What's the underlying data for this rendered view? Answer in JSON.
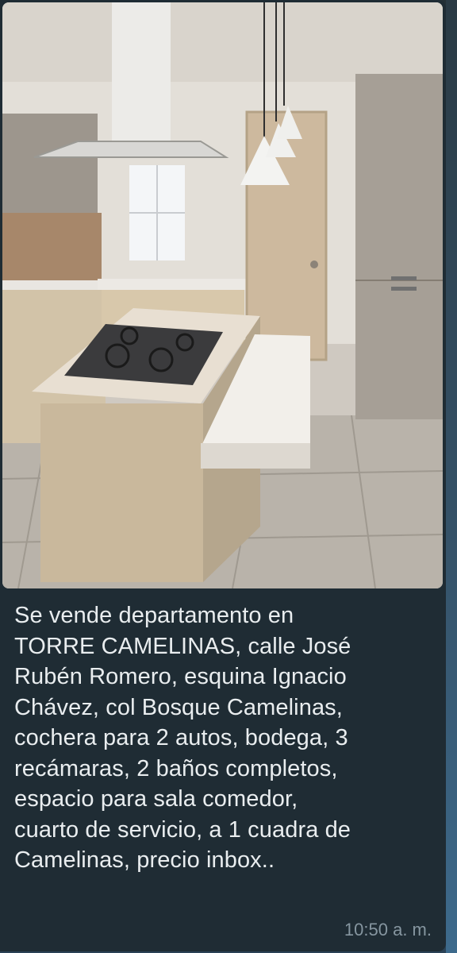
{
  "message": {
    "image": {
      "alt_icon": "kitchen-photo"
    },
    "text": "Se vende departamento en\nTORRE CAMELINAS, calle José\nRubén Romero, esquina Ignacio\nChávez, col Bosque Camelinas,\ncochera para 2 autos,  bodega, 3\nrecámaras, 2 baños completos,\nespacio para sala comedor,\ncuarto de servicio,  a 1 cuadra de\nCamelinas, precio inbox..",
    "timestamp": "10:50 a. m."
  },
  "colors": {
    "bubble": "#1f2c34",
    "text": "#e9edef",
    "timestamp": "#8696a0"
  }
}
